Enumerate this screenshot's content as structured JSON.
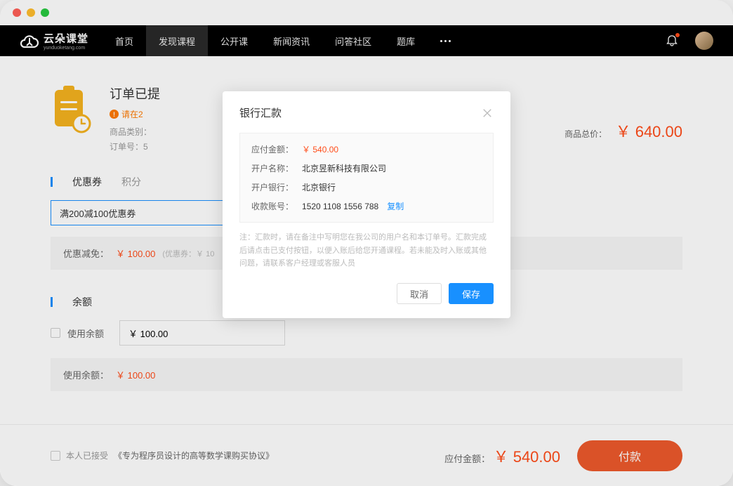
{
  "logo": {
    "main": "云朵课堂",
    "sub": "yunduoketang.com"
  },
  "nav": {
    "items": [
      "首页",
      "发现课程",
      "公开课",
      "新闻资讯",
      "问答社区",
      "题库"
    ],
    "activeIndex": 1
  },
  "order": {
    "title": "订单已提",
    "warning": "请在2",
    "meta1": "商品类别：",
    "meta2": "订单号：5",
    "priceLabel": "商品总价：",
    "priceValue": "￥ 640.00"
  },
  "tabs": {
    "coupon": "优惠券",
    "points": "积分"
  },
  "coupon": {
    "value": "满200减100优惠券"
  },
  "discount": {
    "label": "优惠减免：",
    "amount": "￥ 100.00",
    "note": "(优惠券：￥ 10"
  },
  "balance": {
    "sectionTitle": "余额",
    "useLabel": "使用余额",
    "inputValue": "￥ 100.00",
    "usedLabel": "使用余额：",
    "usedAmount": "￥ 100.00"
  },
  "footer": {
    "agreePrefix": "本人已接受",
    "agreeLink": "《专为程序员设计的高等数学课购买协议》",
    "payableLabel": "应付金额：",
    "payableAmount": "￥ 540.00",
    "payBtn": "付款"
  },
  "modal": {
    "title": "银行汇款",
    "rows": {
      "amountLabel": "应付金额：",
      "amountValue": "￥ 540.00",
      "nameLabel": "开户名称：",
      "nameValue": "北京昱新科技有限公司",
      "bankLabel": "开户银行：",
      "bankValue": "北京银行",
      "acctLabel": "收款账号：",
      "acctValue": "1520 1108 1556 788",
      "copy": "复制"
    },
    "note": "注：汇款时，请在备注中写明您在我公司的用户名和本订单号。汇款完成后请点击已支付按钮，以便入账后给您开通课程。若未能及时入账或其他问题，请联系客户经理或客服人员",
    "cancel": "取消",
    "save": "保存"
  }
}
